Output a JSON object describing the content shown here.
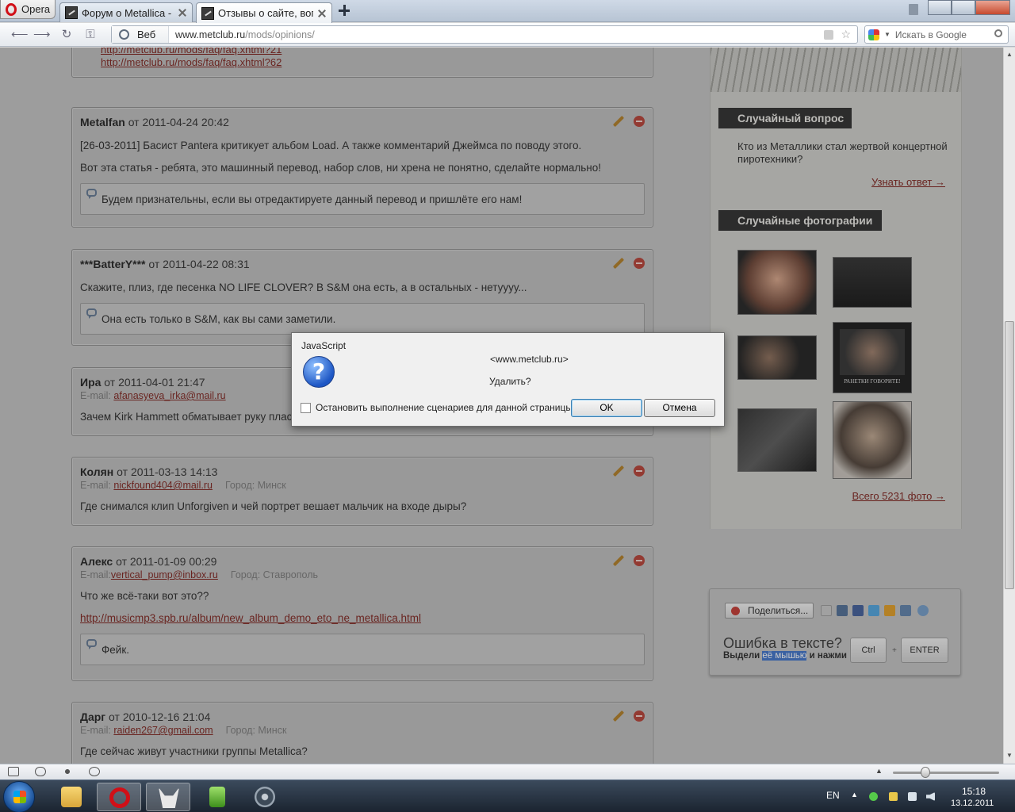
{
  "browser": {
    "menu_label": "Opera",
    "tabs": [
      {
        "title": "Форум о Metallica - Вс..."
      },
      {
        "title": "Отзывы о сайте, вопр..."
      }
    ],
    "address": {
      "mode_label": "Веб",
      "url_host": "www.metclub.ru",
      "url_path": "/mods/opinions/"
    },
    "search_placeholder": "Искать в Google"
  },
  "posts": [
    {
      "top_links": [
        "http://metclub.ru/mods/faq/faq.xhtml?21",
        "http://metclub.ru/mods/faq/faq.xhtml?62"
      ]
    },
    {
      "author": "Metalfan",
      "date": "от 2011-04-24 20:42",
      "paragraphs": [
        "[26-03-2011] Басист Pantera критикует альбом Load. А также комментарий Джеймса по поводу этого.",
        "Вот эта статья - ребята, это машинный перевод, набор слов, ни хрена не понятно, сделайте нормально!"
      ],
      "reply": "Будем признательны, если вы отредактируете данный перевод и пришлёте его нам!"
    },
    {
      "author": "***BatterY***",
      "date": "от 2011-04-22 08:31",
      "paragraphs": [
        "Скажите, плиз, где песенка NO LIFE CLOVER? В S&M она есть, а в остальных - нетуууу..."
      ],
      "reply": "Она есть только в S&M, как вы сами заметили."
    },
    {
      "author": "Ира",
      "date": "от 2011-04-01 21:47",
      "email_label": "E-mail:",
      "email": "afanasyeva_irka@mail.ru",
      "paragraphs": [
        "Зачем Kirk Hammett обматывает руку пласт"
      ]
    },
    {
      "author": "Колян",
      "date": "от 2011-03-13 14:13",
      "email_label": "E-mail:",
      "email": "nickfound404@mail.ru",
      "city": "Город: Минск",
      "paragraphs": [
        "Где снимался клип Unforgiven и чей портрет вешает мальчик на входе дыры?"
      ]
    },
    {
      "author": "Алекс",
      "date": "от 2011-01-09 00:29",
      "email_label": "E-mail:",
      "email": "vertical_pump@inbox.ru",
      "city": "Город: Ставрополь",
      "paragraphs": [
        "Что же всё-таки вот это??"
      ],
      "link": "http://musicmp3.spb.ru/album/new_album_demo_eto_ne_metallica.html",
      "reply": "Фейк."
    },
    {
      "author": "Дарг",
      "date": "от 2010-12-16 21:04",
      "email_label": "E-mail:",
      "email": "raiden267@gmail.com",
      "city": "Город: Минск",
      "paragraphs": [
        "Где сейчас живут участники группы Metallica?"
      ]
    }
  ],
  "sidebar": {
    "random_question_title": "Случайный вопрос",
    "random_question_text": "Кто из Металлики стал жертвой концертной пиротехники?",
    "answer_link": "Узнать ответ →",
    "random_photos_title": "Случайные фотографии",
    "poster_caption": "РАНЕТКИ ГОВОРИТЕ!",
    "all_photos_link": "Всего 5231 фото →"
  },
  "share": {
    "button_label": "Поделиться...",
    "error_title": "Ошибка в тексте?",
    "error_pre": "Выдели",
    "error_highlight": "её мышью",
    "error_post": "и нажми",
    "key_ctrl": "Ctrl",
    "key_plus": "+",
    "key_enter": "ENTER"
  },
  "dialog": {
    "title": "JavaScript",
    "icon_glyph": "?",
    "host": "<www.metclub.ru>",
    "message": "Удалить?",
    "checkbox_label": "Остановить выполнение сценариев для данной страницы",
    "ok_label": "OK",
    "cancel_label": "Отмена"
  },
  "taskbar": {
    "language": "EN",
    "time": "15:18",
    "date": "13.12.2011"
  },
  "colors": {
    "link": "#7a1a14",
    "accent_blue": "#3a6fca"
  }
}
